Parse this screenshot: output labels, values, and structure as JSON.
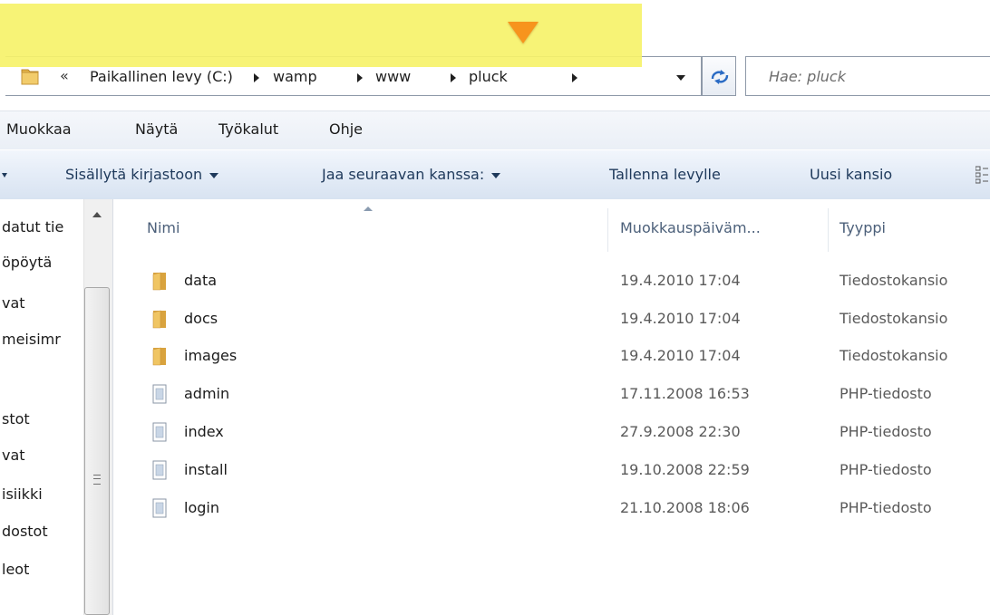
{
  "address_bar": {
    "overflow_chevrons": "«",
    "breadcrumbs": [
      "Paikallinen levy (C:)",
      "wamp",
      "www",
      "pluck"
    ]
  },
  "search": {
    "placeholder": "Hae: pluck"
  },
  "menu": {
    "items": [
      "Muokkaa",
      "Näytä",
      "Työkalut",
      "Ohje"
    ]
  },
  "toolbar": {
    "include_in_library": "Sisällytä kirjastoon",
    "share_with": "Jaa seuraavan kanssa:",
    "burn": "Tallenna levylle",
    "new_folder": "Uusi kansio"
  },
  "nav_pane": {
    "items": [
      "datut tie",
      "öpöytä",
      "vat",
      "meisimr",
      "stot",
      "vat",
      "isiikki",
      "dostot",
      "leot"
    ]
  },
  "file_list": {
    "columns": {
      "name": "Nimi",
      "date_modified": "Muokkauspäiväm...",
      "type": "Tyyppi"
    },
    "rows": [
      {
        "name": "data",
        "date": "19.4.2010 17:04",
        "type": "Tiedostokansio",
        "icon": "folder-icon"
      },
      {
        "name": "docs",
        "date": "19.4.2010 17:04",
        "type": "Tiedostokansio",
        "icon": "folder-icon"
      },
      {
        "name": "images",
        "date": "19.4.2010 17:04",
        "type": "Tiedostokansio",
        "icon": "folder-icon"
      },
      {
        "name": "admin",
        "date": "17.11.2008 16:53",
        "type": "PHP-tiedosto",
        "icon": "php-file-icon"
      },
      {
        "name": "index",
        "date": "27.9.2008 22:30",
        "type": "PHP-tiedosto",
        "icon": "php-file-icon"
      },
      {
        "name": "install",
        "date": "19.10.2008 22:59",
        "type": "PHP-tiedosto",
        "icon": "php-file-icon"
      },
      {
        "name": "login",
        "date": "21.10.2008 18:06",
        "type": "PHP-tiedosto",
        "icon": "php-file-icon"
      }
    ]
  },
  "colors": {
    "highlight": "#f6f26a",
    "arrow": "#f7941d",
    "command_text": "#1e395b",
    "folder": "#e8b64a"
  }
}
